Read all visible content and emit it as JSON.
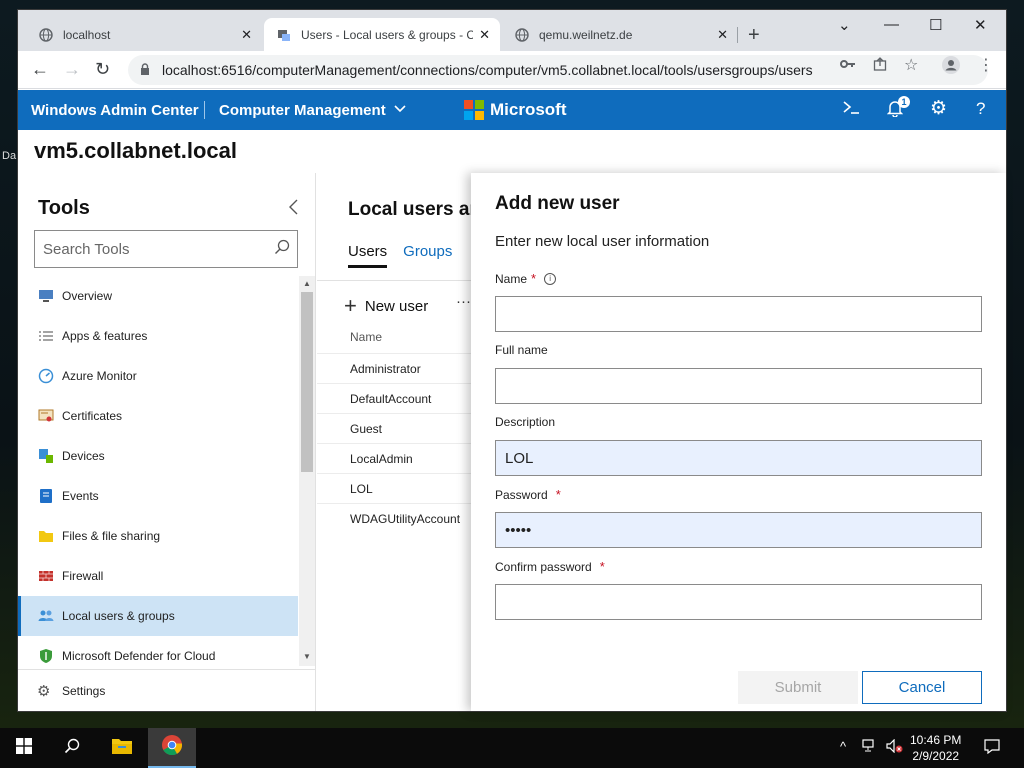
{
  "desktop": {
    "edge_label": "Da"
  },
  "browser": {
    "tabs": [
      {
        "title": "localhost",
        "icon": "globe-icon"
      },
      {
        "title": "Users - Local users & groups - C",
        "icon": "wac-icon",
        "active": true
      },
      {
        "title": "qemu.weilnetz.de",
        "icon": "globe-icon"
      }
    ],
    "new_tab_glyph": "+",
    "url": "localhost:6516/computerManagement/connections/computer/vm5.collabnet.local/tools/usersgroups/users"
  },
  "header": {
    "app_name": "Windows Admin Center",
    "module": "Computer Management",
    "brand": "Microsoft",
    "brand_colors": [
      "#f25022",
      "#7fba00",
      "#00a4ef",
      "#ffb900"
    ],
    "notification_count": "1",
    "accent": "#0f6cbd"
  },
  "server_name": "vm5.collabnet.local",
  "tools": {
    "title": "Tools",
    "search_placeholder": "Search Tools",
    "items": [
      {
        "label": "Overview",
        "icon": "overview-icon"
      },
      {
        "label": "Apps & features",
        "icon": "list-icon"
      },
      {
        "label": "Azure Monitor",
        "icon": "azure-monitor-icon"
      },
      {
        "label": "Certificates",
        "icon": "certificate-icon"
      },
      {
        "label": "Devices",
        "icon": "devices-icon"
      },
      {
        "label": "Events",
        "icon": "events-icon"
      },
      {
        "label": "Files & file sharing",
        "icon": "folder-icon"
      },
      {
        "label": "Firewall",
        "icon": "firewall-icon"
      },
      {
        "label": "Local users & groups",
        "icon": "users-icon",
        "selected": true
      },
      {
        "label": "Microsoft Defender for Cloud",
        "icon": "shield-icon"
      }
    ],
    "settings_label": "Settings"
  },
  "main": {
    "title": "Local users ar",
    "tabs": [
      {
        "label": "Users",
        "active": true
      },
      {
        "label": "Groups"
      }
    ],
    "new_user_label": "New user",
    "more_glyph": "···",
    "column_header": "Name",
    "users": [
      "Administrator",
      "DefaultAccount",
      "Guest",
      "LocalAdmin",
      "LOL",
      "WDAGUtilityAccount"
    ]
  },
  "dialog": {
    "title": "Add new user",
    "subtitle": "Enter new local user information",
    "fields": {
      "name": {
        "label": "Name",
        "value": ""
      },
      "full_name": {
        "label": "Full name",
        "value": ""
      },
      "description": {
        "label": "Description",
        "value": "LOL"
      },
      "password": {
        "label": "Password",
        "value": "•••••"
      },
      "confirm_password": {
        "label": "Confirm password",
        "value": ""
      }
    },
    "submit_label": "Submit",
    "cancel_label": "Cancel"
  },
  "taskbar": {
    "time": "10:46 PM",
    "date": "2/9/2022"
  }
}
